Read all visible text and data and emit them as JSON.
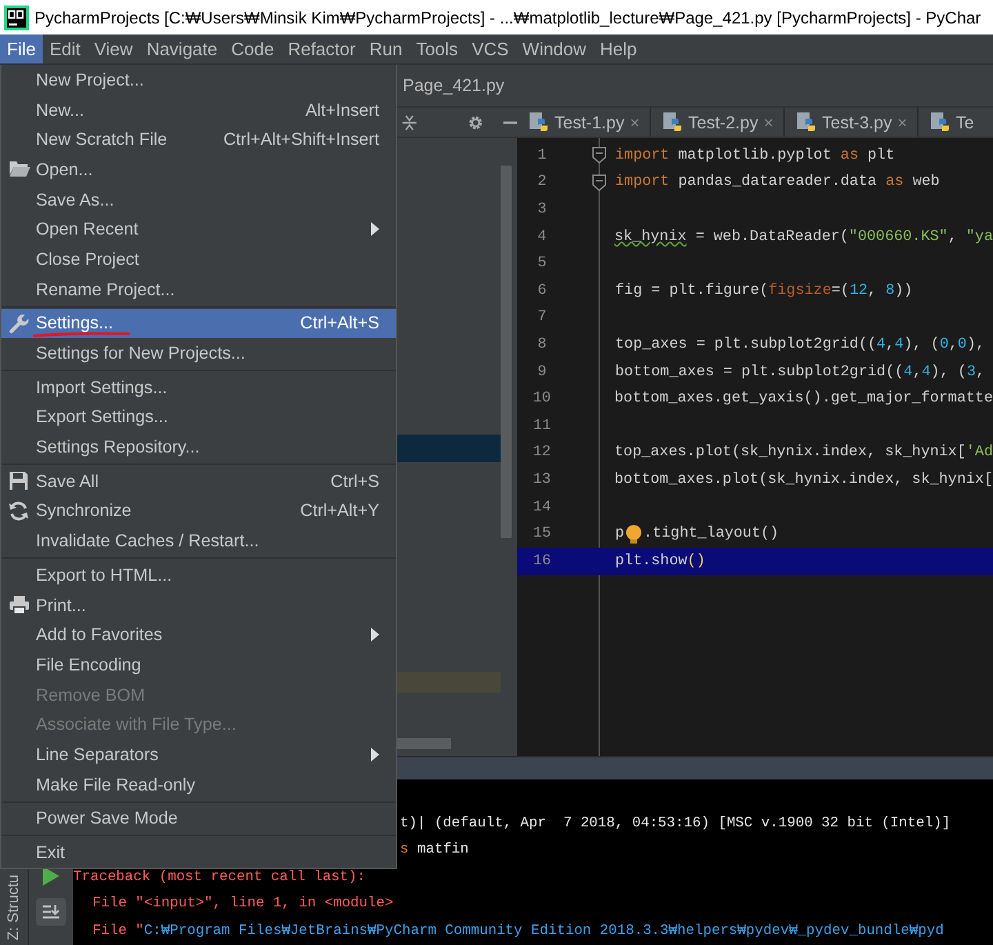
{
  "window": {
    "title": "PycharmProjects [C:₩Users₩Minsik Kim₩PycharmProjects] - ...₩matplotlib_lecture₩Page_421.py [PycharmProjects] - PyChar"
  },
  "menubar": [
    {
      "label": "File",
      "selected": true
    },
    {
      "label": "Edit",
      "selected": false
    },
    {
      "label": "View",
      "selected": false
    },
    {
      "label": "Navigate",
      "selected": false
    },
    {
      "label": "Code",
      "selected": false
    },
    {
      "label": "Refactor",
      "selected": false
    },
    {
      "label": "Run",
      "selected": false
    },
    {
      "label": "Tools",
      "selected": false
    },
    {
      "label": "VCS",
      "selected": false
    },
    {
      "label": "Window",
      "selected": false
    },
    {
      "label": "Help",
      "selected": false
    }
  ],
  "file_menu": {
    "items": [
      {
        "kind": "item",
        "label": "New Project...",
        "submenu": false,
        "disabled": false,
        "selected": false
      },
      {
        "kind": "item",
        "label": "New...",
        "shortcut": "Alt+Insert",
        "submenu": false,
        "disabled": false,
        "selected": false
      },
      {
        "kind": "item",
        "label": "New Scratch File",
        "shortcut": "Ctrl+Alt+Shift+Insert",
        "submenu": false,
        "disabled": false,
        "selected": false
      },
      {
        "kind": "item",
        "label": "Open...",
        "submenu": false,
        "disabled": false,
        "selected": false
      },
      {
        "kind": "item",
        "label": "Save As...",
        "submenu": false,
        "disabled": false,
        "selected": false
      },
      {
        "kind": "item",
        "label": "Open Recent",
        "submenu": true,
        "disabled": false,
        "selected": false
      },
      {
        "kind": "item",
        "label": "Close Project",
        "submenu": false,
        "disabled": false,
        "selected": false
      },
      {
        "kind": "item",
        "label": "Rename Project...",
        "submenu": false,
        "disabled": false,
        "selected": false
      },
      {
        "kind": "separator"
      },
      {
        "kind": "item",
        "label": "Settings...",
        "shortcut": "Ctrl+Alt+S",
        "marked": true,
        "submenu": false,
        "disabled": false,
        "selected": true
      },
      {
        "kind": "item",
        "label": "Settings for New Projects...",
        "submenu": false,
        "disabled": false,
        "selected": false
      },
      {
        "kind": "separator"
      },
      {
        "kind": "item",
        "label": "Import Settings...",
        "submenu": false,
        "disabled": false,
        "selected": false
      },
      {
        "kind": "item",
        "label": "Export Settings...",
        "submenu": false,
        "disabled": false,
        "selected": false
      },
      {
        "kind": "item",
        "label": "Settings Repository...",
        "submenu": false,
        "disabled": false,
        "selected": false
      },
      {
        "kind": "separator"
      },
      {
        "kind": "item",
        "label": "Save All",
        "shortcut": "Ctrl+S",
        "submenu": false,
        "disabled": false,
        "selected": false
      },
      {
        "kind": "item",
        "label": "Synchronize",
        "shortcut": "Ctrl+Alt+Y",
        "submenu": false,
        "disabled": false,
        "selected": false
      },
      {
        "kind": "item",
        "label": "Invalidate Caches / Restart...",
        "submenu": false,
        "disabled": false,
        "selected": false
      },
      {
        "kind": "separator"
      },
      {
        "kind": "item",
        "label": "Export to HTML...",
        "submenu": false,
        "disabled": false,
        "selected": false
      },
      {
        "kind": "item",
        "label": "Print...",
        "submenu": false,
        "disabled": false,
        "selected": false
      },
      {
        "kind": "item",
        "label": "Add to Favorites",
        "submenu": true,
        "disabled": false,
        "selected": false
      },
      {
        "kind": "item",
        "label": "File Encoding",
        "submenu": false,
        "disabled": false,
        "selected": false
      },
      {
        "kind": "item",
        "label": "Remove BOM",
        "submenu": false,
        "disabled": true,
        "selected": false
      },
      {
        "kind": "item",
        "label": "Associate with File Type...",
        "submenu": false,
        "disabled": true,
        "selected": false
      },
      {
        "kind": "item",
        "label": "Line Separators",
        "submenu": true,
        "disabled": false,
        "selected": false
      },
      {
        "kind": "item",
        "label": "Make File Read-only",
        "submenu": false,
        "disabled": false,
        "selected": false
      },
      {
        "kind": "separator"
      },
      {
        "kind": "item",
        "label": "Power Save Mode",
        "submenu": false,
        "disabled": false,
        "selected": false
      },
      {
        "kind": "separator"
      },
      {
        "kind": "item",
        "label": "Exit",
        "submenu": false,
        "disabled": false,
        "selected": false
      }
    ]
  },
  "navigation_bar": {
    "file": "Page_421.py"
  },
  "editor_tabs": [
    {
      "label": "Test-1.py",
      "close": "×",
      "selected": false
    },
    {
      "label": "Test-2.py",
      "close": "×",
      "selected": false
    },
    {
      "label": "Test-3.py",
      "close": "×",
      "selected": false
    },
    {
      "label": "Te",
      "selected": false
    }
  ],
  "editor": {
    "lines": [
      {
        "number": "1",
        "fold": true,
        "current": false,
        "tokens": [
          {
            "kind": "keyword",
            "text": "import"
          },
          {
            "kind": "plain",
            "text": " matplotlib.pyplot "
          },
          {
            "kind": "keyword",
            "text": "as"
          },
          {
            "kind": "plain",
            "text": " plt"
          }
        ]
      },
      {
        "number": "2",
        "fold": true,
        "current": false,
        "tokens": [
          {
            "kind": "keyword",
            "text": "import"
          },
          {
            "kind": "plain",
            "text": " pandas_datareader.data "
          },
          {
            "kind": "keyword",
            "text": "as"
          },
          {
            "kind": "plain",
            "text": " web"
          }
        ]
      },
      {
        "number": "3",
        "fold": false,
        "current": false
      },
      {
        "number": "4",
        "fold": false,
        "current": false,
        "tokens": [
          {
            "kind": "warning",
            "text": "sk_hynix"
          },
          {
            "kind": "plain",
            "text": " = web.DataReader("
          },
          {
            "kind": "string",
            "text": "\"000660.KS\""
          },
          {
            "kind": "plain",
            "text": ", "
          },
          {
            "kind": "string",
            "text": "\"ya"
          }
        ]
      },
      {
        "number": "5",
        "fold": false,
        "current": false
      },
      {
        "number": "6",
        "fold": false,
        "current": false,
        "tokens": [
          {
            "kind": "plain",
            "text": "fig = plt.figure("
          },
          {
            "kind": "param",
            "text": "figsize"
          },
          {
            "kind": "plain",
            "text": "=("
          },
          {
            "kind": "number",
            "text": "12"
          },
          {
            "kind": "plain",
            "text": ", "
          },
          {
            "kind": "number",
            "text": "8"
          },
          {
            "kind": "plain",
            "text": "))"
          }
        ]
      },
      {
        "number": "7",
        "fold": false,
        "current": false
      },
      {
        "number": "8",
        "fold": false,
        "current": false,
        "tokens": [
          {
            "kind": "plain",
            "text": "top_axes = plt.subplot2grid(("
          },
          {
            "kind": "number",
            "text": "4"
          },
          {
            "kind": "plain",
            "text": ","
          },
          {
            "kind": "number",
            "text": "4"
          },
          {
            "kind": "plain",
            "text": "), ("
          },
          {
            "kind": "number",
            "text": "0"
          },
          {
            "kind": "plain",
            "text": ","
          },
          {
            "kind": "number",
            "text": "0"
          },
          {
            "kind": "plain",
            "text": "),"
          }
        ]
      },
      {
        "number": "9",
        "fold": false,
        "current": false,
        "tokens": [
          {
            "kind": "plain",
            "text": "bottom_axes = plt.subplot2grid(("
          },
          {
            "kind": "number",
            "text": "4"
          },
          {
            "kind": "plain",
            "text": ","
          },
          {
            "kind": "number",
            "text": "4"
          },
          {
            "kind": "plain",
            "text": "), ("
          },
          {
            "kind": "number",
            "text": "3"
          },
          {
            "kind": "plain",
            "text": ","
          }
        ]
      },
      {
        "number": "10",
        "fold": false,
        "current": false,
        "tokens": [
          {
            "kind": "plain",
            "text": "bottom_axes.get_yaxis().get_major_formatte"
          }
        ]
      },
      {
        "number": "11",
        "fold": false,
        "current": false
      },
      {
        "number": "12",
        "fold": false,
        "current": false,
        "tokens": [
          {
            "kind": "plain",
            "text": "top_axes.plot(sk_hynix.index, sk_hynix["
          },
          {
            "kind": "string",
            "text": "'Ad"
          }
        ]
      },
      {
        "number": "13",
        "fold": false,
        "current": false,
        "tokens": [
          {
            "kind": "plain",
            "text": "bottom_axes.plot(sk_hynix.index, sk_hynix["
          }
        ]
      },
      {
        "number": "14",
        "fold": false,
        "current": false
      },
      {
        "number": "15",
        "fold": false,
        "current": false,
        "tokens": [
          {
            "kind": "plain",
            "text": "p"
          },
          {
            "kind": "bulb"
          },
          {
            "kind": "plain",
            "text": ".tight_layout()"
          }
        ]
      },
      {
        "number": "16",
        "fold": false,
        "current": true,
        "tokens": [
          {
            "kind": "plain",
            "text": "plt.show"
          },
          {
            "kind": "brace",
            "text": "()"
          }
        ]
      }
    ]
  },
  "run_panel": {
    "side_tab": "Z: Structu",
    "console": [
      {
        "covered": true,
        "indented": false,
        "tokens": [
          {
            "kind": "plain",
            "text": "t)| (default, Apr  7 2018, 04:53:16) [MSC v.1900 32 bit (Intel)]"
          }
        ]
      },
      {
        "covered": true,
        "indented": false,
        "tokens": [
          {
            "kind": "keyword",
            "text": "s"
          },
          {
            "kind": "plain",
            "text": " matfin"
          }
        ]
      },
      {
        "covered": false,
        "indented": false,
        "tokens": [
          {
            "kind": "error",
            "text": "Traceback (most recent call last):"
          }
        ]
      },
      {
        "covered": false,
        "indented": true,
        "tokens": [
          {
            "kind": "error",
            "text": "File \"<input>\", line 1, in <module>"
          }
        ]
      },
      {
        "covered": false,
        "indented": true,
        "tokens": [
          {
            "kind": "error",
            "text": "File \""
          },
          {
            "kind": "link",
            "text": "C:₩Program Files₩JetBrains₩PyCharm Community Edition 2018.3.3₩helpers₩pydev₩_pydev_bundle₩pyd"
          }
        ]
      }
    ]
  }
}
